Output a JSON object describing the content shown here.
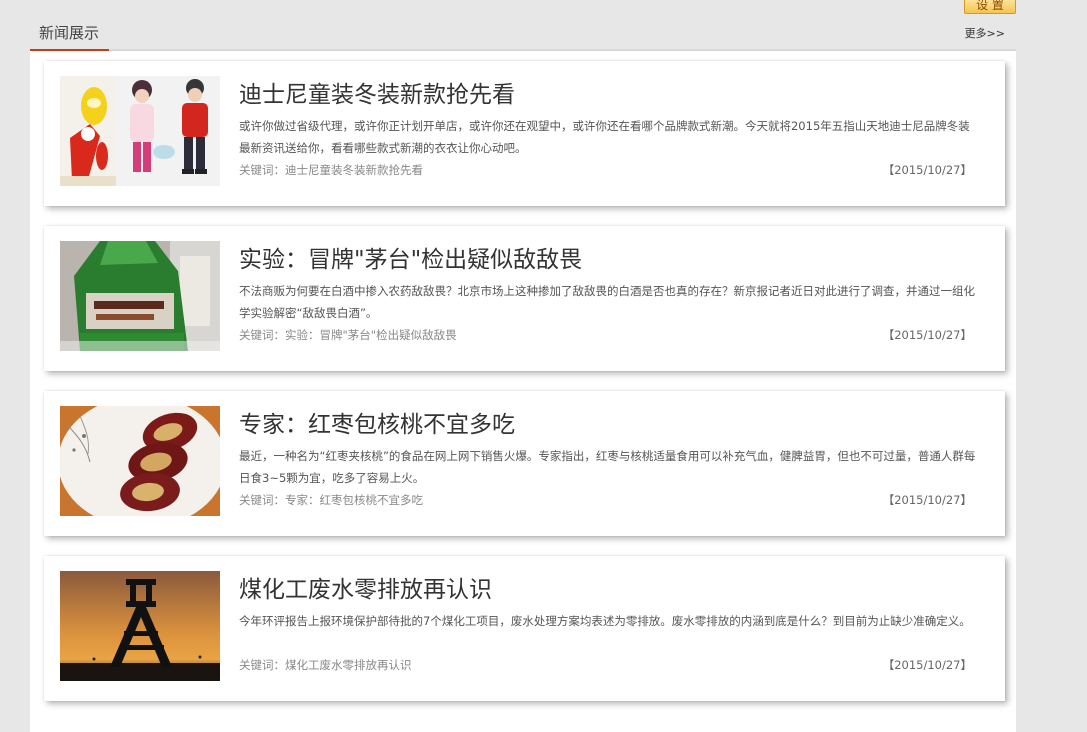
{
  "settings_label": "设 置",
  "section": {
    "title": "新闻展示",
    "more_label": "更多>>"
  },
  "news": [
    {
      "title": "迪士尼童装冬装新款抢先看",
      "summary": "或许你做过省级代理，或许你正计划开单店，或许你还在观望中，或许你还在看哪个品牌款式新潮。今天就将2015年五指山天地迪士尼品牌冬装最新资讯送给你，看看哪些款式新潮的衣衣让你心动吧。",
      "keywords": "关键词：迪士尼童装冬装新款抢先看",
      "date": "【2015/10/27】"
    },
    {
      "title": "实验：冒牌\"茅台\"检出疑似敌敌畏",
      "summary": "不法商贩为何要在白酒中掺入农药敌敌畏？北京市场上这种掺加了敌敌畏的白酒是否也真的存在？新京报记者近日对此进行了调查，并通过一组化学实验解密“敌敌畏白酒”。",
      "keywords": "关键词：实验：冒牌\"茅台\"检出疑似敌敌畏",
      "date": "【2015/10/27】"
    },
    {
      "title": "专家：红枣包核桃不宜多吃",
      "summary": "最近，一种名为“红枣夹核桃”的食品在网上网下销售火爆。专家指出，红枣与核桃适量食用可以补充气血，健脾益胃，但也不可过量，普通人群每日食3~5颗为宜，吃多了容易上火。",
      "keywords": "关键词：专家：红枣包核桃不宜多吃",
      "date": "【2015/10/27】"
    },
    {
      "title": "煤化工废水零排放再认识",
      "summary": "今年环评报告上报环境保护部待批的7个煤化工项目，废水处理方案均表述为零排放。废水零排放的内涵到底是什么？到目前为止缺少准确定义。",
      "keywords": "关键词：煤化工废水零排放再认识",
      "date": "【2015/10/27】"
    }
  ]
}
